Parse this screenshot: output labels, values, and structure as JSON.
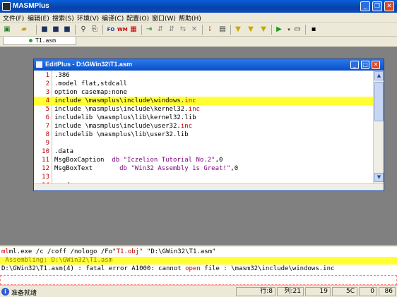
{
  "window": {
    "title": "MASMPlus"
  },
  "menu": [
    "文件(F)",
    "编辑(E)",
    "搜索(S)",
    "环境(V)",
    "编译(C)",
    "配置(O)",
    "窗口(W)",
    "帮助(H)"
  ],
  "toolbar": {
    "icons": [
      "new-file-icon",
      "open-folder-icon",
      "save-icon",
      "save-as-icon",
      "save-all-icon",
      "find-icon",
      "replace-icon",
      "fo-icon",
      "wm-icon",
      "build-icon",
      "step-icon",
      "pause-icon",
      "stop-icon",
      "debug-icon",
      "clear-icon",
      "breakpoint-icon",
      "calc-icon",
      "funnel-1-icon",
      "funnel-2-icon",
      "funnel-3-icon",
      "run-icon",
      "dropdown-icon",
      "window-icon",
      "terminal-icon"
    ],
    "fo_label": "FO",
    "wm_label": "WM"
  },
  "tab": {
    "label": "T1.asm"
  },
  "editor": {
    "title": "EditPlus - D:\\GWin32\\T1.asm",
    "lines": [
      {
        "n": "1",
        "text": ".386",
        "hl": false
      },
      {
        "n": "2",
        "text": ".model flat,stdcall",
        "hl": false
      },
      {
        "n": "3",
        "text": "option casemap:none",
        "hl": false
      },
      {
        "n": "4",
        "pre": "include \\masmplus\\include\\windows.",
        "post": "inc",
        "hl": true
      },
      {
        "n": "5",
        "pre": "include \\masmplus\\include\\kernel32.",
        "post": "inc",
        "hl": false
      },
      {
        "n": "6",
        "text": "includelib \\masmplus\\lib\\kernel32.lib",
        "hl": false
      },
      {
        "n": "7",
        "pre": "include \\masmplus\\include\\user32.",
        "post": "inc",
        "hl": false
      },
      {
        "n": "8",
        "text": "includelib \\masmplus\\lib\\user32.lib",
        "hl": false
      },
      {
        "n": "9",
        "text": "",
        "hl": false
      },
      {
        "n": "10",
        "text": ".data",
        "hl": false
      },
      {
        "n": "11",
        "name": "MsgBoxCaption  ",
        "kw": "db",
        "str": "\"Iczelion Tutorial No.2\"",
        "tail": ",0"
      },
      {
        "n": "12",
        "name": "MsgBoxText       ",
        "kw": "db",
        "str": "\"Win32 Assembly is Great!\"",
        "tail": ",0"
      },
      {
        "n": "13",
        "text": "",
        "hl": false
      },
      {
        "n": "14",
        "text": ".code",
        "hl": false
      }
    ]
  },
  "output": {
    "cmd_pre": "ml.exe /c /coff /nologo /Fo\"",
    "cmd_obj": "T1.obj\"",
    "cmd_src": " \"D:\\GWin32\\T1.asm\"",
    "assembling": " Assembling: D:\\GWin32\\T1.asm",
    "error_pre": "D:\\GWin32\\T1.asm(4) : fatal error A1000: cannot ",
    "error_open": "open",
    "error_post": " file : \\masm32\\include\\windows.inc"
  },
  "status": {
    "ready": "准备就绪",
    "row": "行:8",
    "col": "列:21",
    "f1": "19",
    "f2": "5C",
    "f3": "0",
    "f4": "86"
  },
  "colors": {
    "highlight": "#ffff33",
    "title_blue": "#0842a8",
    "keyword_red": "#c00000"
  }
}
